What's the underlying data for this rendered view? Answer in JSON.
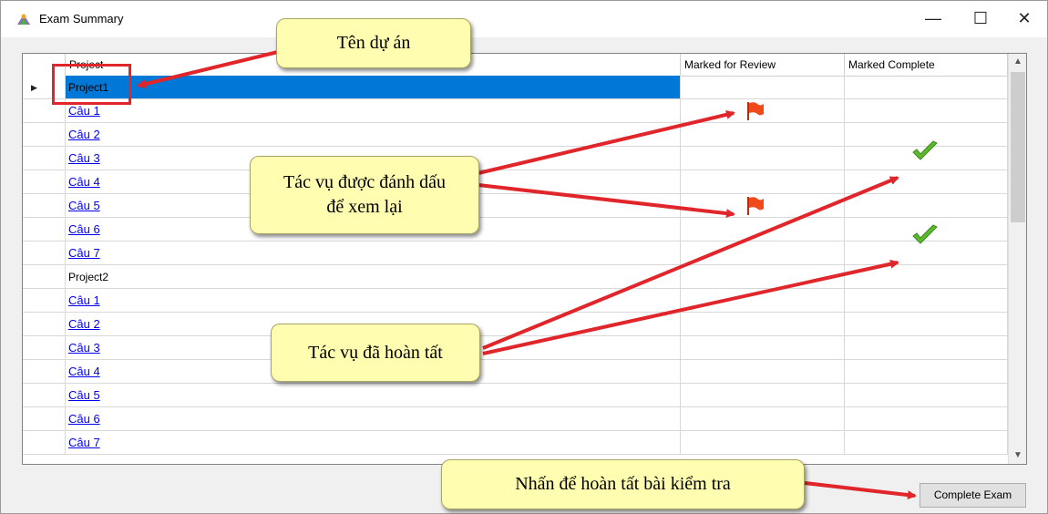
{
  "window": {
    "title": "Exam Summary",
    "controls": {
      "minimize": "—",
      "maximize": "☐",
      "close": "✕"
    }
  },
  "grid": {
    "columns": [
      "Project",
      "Marked for Review",
      "Marked Complete"
    ],
    "rows": [
      {
        "label": "Project1",
        "type": "project",
        "selected": true,
        "review": false,
        "complete": false
      },
      {
        "label": "Câu 1",
        "type": "task",
        "review": true,
        "complete": false
      },
      {
        "label": "Câu 2",
        "type": "task",
        "review": false,
        "complete": false
      },
      {
        "label": "Câu 3",
        "type": "task",
        "review": false,
        "complete": true
      },
      {
        "label": "Câu 4",
        "type": "task",
        "review": false,
        "complete": false
      },
      {
        "label": "Câu 5",
        "type": "task",
        "review": true,
        "complete": false
      },
      {
        "label": "Câu 6",
        "type": "task",
        "review": false,
        "complete": false
      },
      {
        "label": "Câu 7",
        "type": "task",
        "review": false,
        "complete": true
      },
      {
        "label": "Project2",
        "type": "project",
        "review": false,
        "complete": false
      },
      {
        "label": "Câu 1",
        "type": "task",
        "review": false,
        "complete": false
      },
      {
        "label": "Câu 2",
        "type": "task",
        "review": false,
        "complete": false
      },
      {
        "label": "Câu 3",
        "type": "task",
        "review": false,
        "complete": false
      },
      {
        "label": "Câu 4",
        "type": "task",
        "review": false,
        "complete": false
      },
      {
        "label": "Câu 5",
        "type": "task",
        "review": false,
        "complete": false
      },
      {
        "label": "Câu 6",
        "type": "task",
        "review": false,
        "complete": false
      },
      {
        "label": "Câu 7",
        "type": "task",
        "review": false,
        "complete": false
      }
    ]
  },
  "callouts": {
    "project_name": "Tên dự án",
    "marked_review_line1": "Tác vụ được đánh dấu",
    "marked_review_line2": "để xem lại",
    "completed": "Tác vụ đã hoàn tất",
    "complete_exam_hint": "Nhấn để hoàn tất bài kiểm tra"
  },
  "buttons": {
    "complete_exam": "Complete Exam"
  },
  "colors": {
    "selection": "#0078d7",
    "link": "#0000ee",
    "callout_bg": "#fefdb0",
    "arrow": "#e0262b",
    "flag": "#f04a1c",
    "check": "#5cb82e"
  },
  "icons": {
    "review": "flag-icon",
    "complete": "checkmark-icon",
    "current_row": "row-pointer-icon"
  }
}
